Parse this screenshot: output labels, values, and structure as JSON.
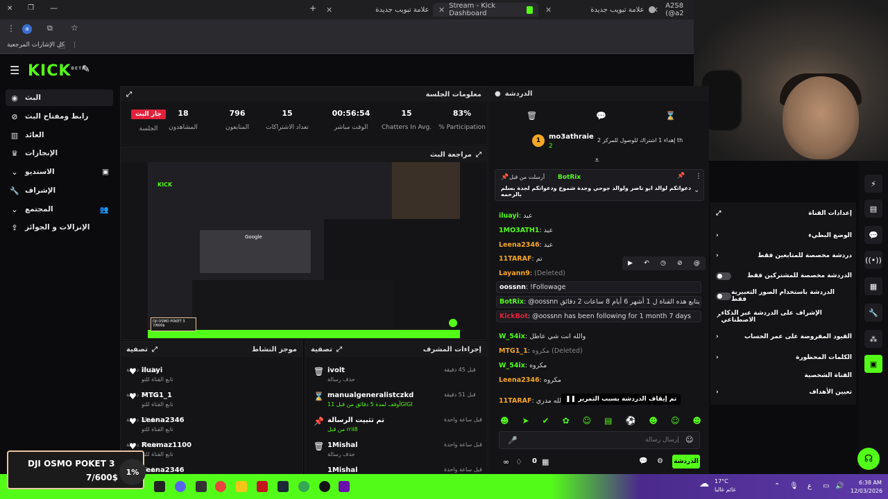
{
  "browser": {
    "tabs": [
      {
        "label": "علامة تبويب جديدة"
      },
      {
        "label": "Stream - Kick Dashboard"
      },
      {
        "label": "علامة تبويب جديدة"
      },
      {
        "label": "A2S8 (@a2"
      }
    ],
    "bookmarks_label": "كل الإشارات المرجعية"
  },
  "app": {
    "logo": "KICK",
    "logo_sup": "BETA"
  },
  "sidebar": {
    "items": [
      {
        "label": "البث",
        "icon": "broadcast-icon"
      },
      {
        "label": "رابط ومفتاح البث",
        "icon": "link-icon"
      },
      {
        "label": "العائد",
        "icon": "bank-icon"
      },
      {
        "label": "الإنجازات",
        "icon": "trophy-icon"
      },
      {
        "label": "الاستديو",
        "icon": "studio-icon"
      },
      {
        "label": "الإشراف",
        "icon": "wrench-icon"
      },
      {
        "label": "المجتمع",
        "icon": "community-icon"
      },
      {
        "label": "الإنزالات و الجوائز",
        "icon": "drops-icon"
      }
    ]
  },
  "session": {
    "title": "معلومات الجلسة",
    "live_badge": "جار البث",
    "live_label": "الجلسة",
    "stats": [
      {
        "value": "18",
        "label": "المشاهدون"
      },
      {
        "value": "796",
        "label": "المتابعون"
      },
      {
        "value": "15",
        "label": "تعداد الاشتراكات"
      },
      {
        "value": "00:56:54",
        "label": "الوقت مباشر"
      },
      {
        "value": "15",
        "label": "Chatters In Avg."
      },
      {
        "value": "83%",
        "label": "% Participation"
      }
    ]
  },
  "preview": {
    "title": "مراجعة البث",
    "overlay_text": "DJI OSMO POKET 3",
    "overlay_sub": "7/600$"
  },
  "activity": {
    "title": "موجز النشاط",
    "filter": "تصفية",
    "rows": [
      {
        "name": "iluayi",
        "sub": "تابع القناة للتو",
        "time": "قبل 35 دقيقة"
      },
      {
        "name": "MTG1_1",
        "sub": "تابع القناة للتو",
        "time": "قبل 37 دقيقة"
      },
      {
        "name": "Leena2346",
        "sub": "تابع القناة للتو",
        "time": "قبل 38 دقيقة"
      },
      {
        "name": "Reemaz1100",
        "sub": "تابع القناة للتو",
        "time": "قبل 38 دقيقة"
      },
      {
        "name": "Leena2346",
        "sub": "",
        "time": "قبل 39 دقيقة"
      }
    ]
  },
  "modactions": {
    "title": "إجراءات المشرف",
    "filter": "تصفية",
    "rows": [
      {
        "name": "ivolt",
        "sub": "حذف رسالة",
        "time": "قبل 45 دقيقة"
      },
      {
        "name": "manualgeneralistczkd",
        "sub": "أوقف لمدة 5 دقائق من قبل 11GIGI",
        "time": "قبل 51 دقيقة"
      },
      {
        "name": "تم تثبيت الرسالة",
        "sub": "من قبل rrii8",
        "time": "قبل ساعة واحدة"
      },
      {
        "name": "1Mishal",
        "sub": "حذف رسالة",
        "time": "قبل ساعة واحدة"
      },
      {
        "name": "1Mishal",
        "sub": "",
        "time": "قبل ساعة واحدة"
      }
    ]
  },
  "chat": {
    "title": "الدردشة",
    "top_user": "mo3athraie",
    "top_user_sub": "2",
    "top_goal": "إهداء 1 اشتراك للوصول للمركز 2 th",
    "pinned_by": "أرسلت من قبل",
    "pinned_user": "BotRix",
    "pinned_msg": "دعواتكم لوالد ابو ناصر ولوالد جوحي وجدة شموخ ودعواتكم لجدة بسلم بالرحمه",
    "lines": [
      {
        "user": "iluayi",
        "text": "عيد",
        "color": "green"
      },
      {
        "user": "1MO3ATH1",
        "text": "عيد",
        "color": "green"
      },
      {
        "user": "Leena2346",
        "text": "عيد",
        "color": "orange"
      },
      {
        "user": "11TARAF",
        "text": "تم",
        "color": "orange"
      },
      {
        "user": "Layann9",
        "text": "(Deleted)",
        "color": "orange"
      },
      {
        "user": "oossnn",
        "text": "!Followage",
        "color": "white"
      },
      {
        "user": "BotRix",
        "text": "@oossnn يتابع هذه القناة ل 1 أشهر 6 أيام 8 ساعات 2 دقائق !",
        "color": "green"
      },
      {
        "user": "KickBot",
        "text": "@oossnn has been following for 1 month 7 days",
        "color": "green"
      },
      {
        "user": "W_54ix",
        "text": "والله انت شي عاطل",
        "color": "green"
      },
      {
        "user": "MTG1_1",
        "text": "مكروه (Deleted)",
        "color": "orange"
      },
      {
        "user": "W_54ix",
        "text": "مكروه",
        "color": "green"
      },
      {
        "user": "Leena2346",
        "text": "مكروه",
        "color": "orange"
      },
      {
        "user": "11TARAF",
        "text": "والله مدري",
        "color": "orange"
      }
    ],
    "paused": "تم إيقاف الدردشة بسبب التمرير",
    "input_placeholder": "إرسال رسالة",
    "send_label": "الدردشة",
    "count": "0"
  },
  "settings": {
    "title": "إعدادات القناة",
    "rows": [
      {
        "label": "الوضع البطيء",
        "control": "chevron"
      },
      {
        "label": "دردشة مخصصة للمتابعين فقط",
        "control": "chevron"
      },
      {
        "label": "الدردشة مخصصة للمشتركين فقط",
        "control": "toggle"
      },
      {
        "label": "الدردشة باستخدام الصور التعبيرية فقط",
        "control": "toggle"
      },
      {
        "label": "الإشراف على الدردشة عبر الذكاء الاصطناعي",
        "control": "external"
      },
      {
        "label": "القيود المفروضة على عمر الحساب",
        "control": "chevron"
      },
      {
        "label": "الكلمات المحظورة",
        "control": "chevron"
      }
    ],
    "section": "القناة الشخصية",
    "goals": "تعيين الأهداف"
  },
  "promo": {
    "title": "DJI OSMO POKET 3",
    "progress": "7/600$",
    "percent": "1%"
  },
  "taskbar": {
    "weather_temp": "17°C",
    "weather_sub": "غائم غالبا",
    "time": "6:38 AM",
    "date": "12/03/2026",
    "lang": "ع"
  },
  "colors": {
    "accent": "#53fc18",
    "live": "#e3213b",
    "bg": "#0b0b0d",
    "panel": "#141416"
  }
}
